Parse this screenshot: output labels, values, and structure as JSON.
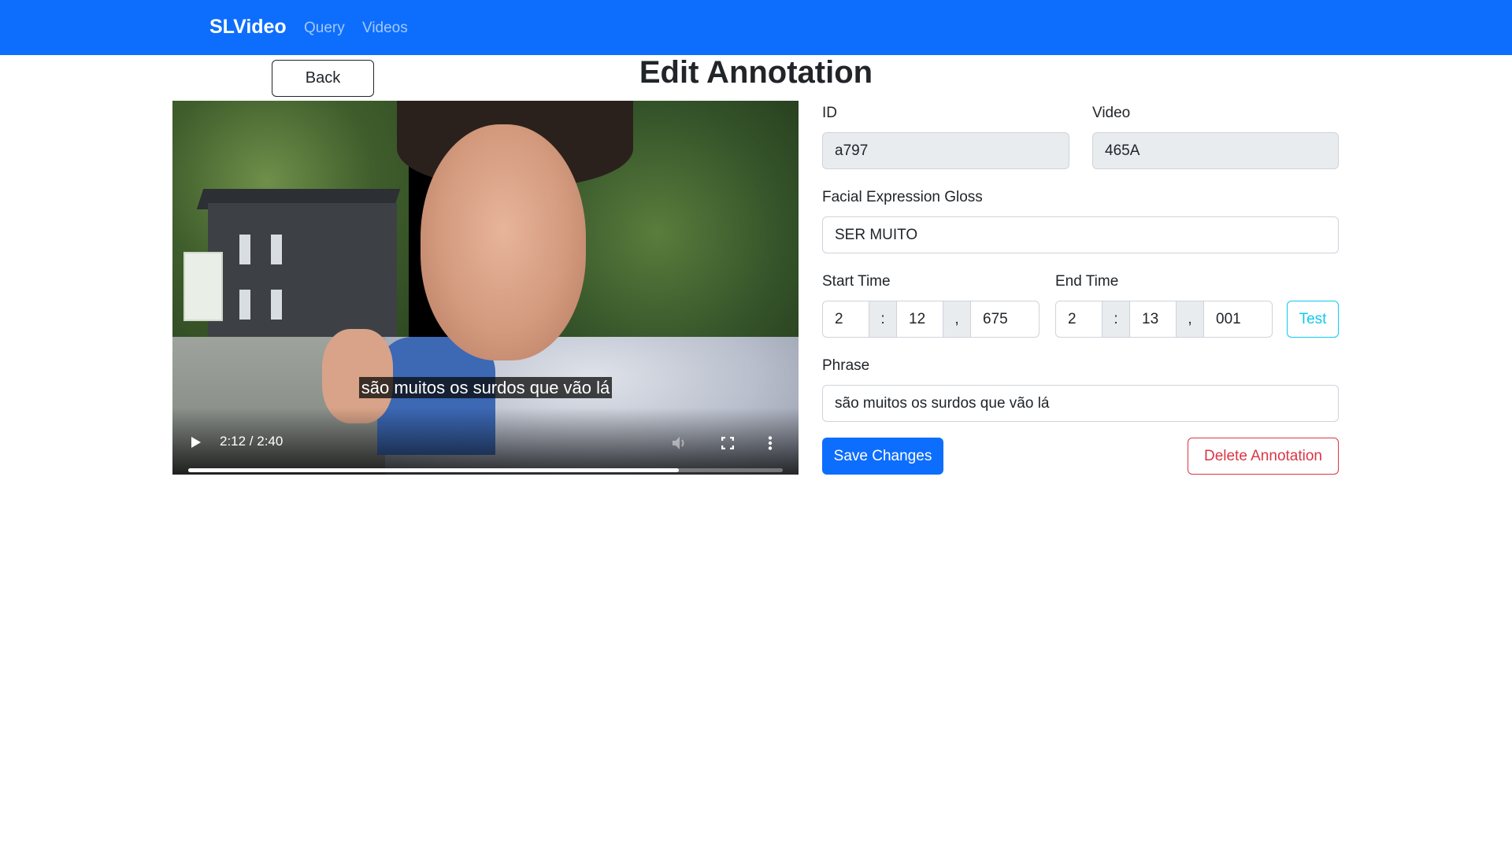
{
  "navbar": {
    "brand": "SLVideo",
    "links": [
      {
        "label": "Query"
      },
      {
        "label": "Videos"
      }
    ],
    "background": "#0d6efd"
  },
  "page": {
    "back_label": "Back",
    "title": "Edit Annotation"
  },
  "video_player": {
    "subtitle": "são muitos os surdos que vão lá",
    "time_display": "2:12 / 2:40",
    "progress_fraction": 0.825,
    "icons": [
      "play-icon",
      "mute-icon",
      "fullscreen-icon",
      "more-options-icon"
    ]
  },
  "form": {
    "id_label": "ID",
    "id_value": "a797",
    "video_label": "Video",
    "video_value": "465A",
    "gloss_label": "Facial Expression Gloss",
    "gloss_value": "SER MUITO",
    "start_label": "Start Time",
    "start_minutes": "2",
    "start_seconds": "12",
    "start_millis": "675",
    "end_label": "End Time",
    "end_minutes": "2",
    "end_seconds": "13",
    "end_millis": "001",
    "colon": ":",
    "comma": ",",
    "test_label": "Test",
    "phrase_label": "Phrase",
    "phrase_value": "são muitos os surdos que vão lá",
    "save_label": "Save Changes",
    "delete_label": "Delete Annotation"
  },
  "colors": {
    "primary": "#0d6efd",
    "info": "#0dcaf0",
    "danger": "#dc3545"
  }
}
